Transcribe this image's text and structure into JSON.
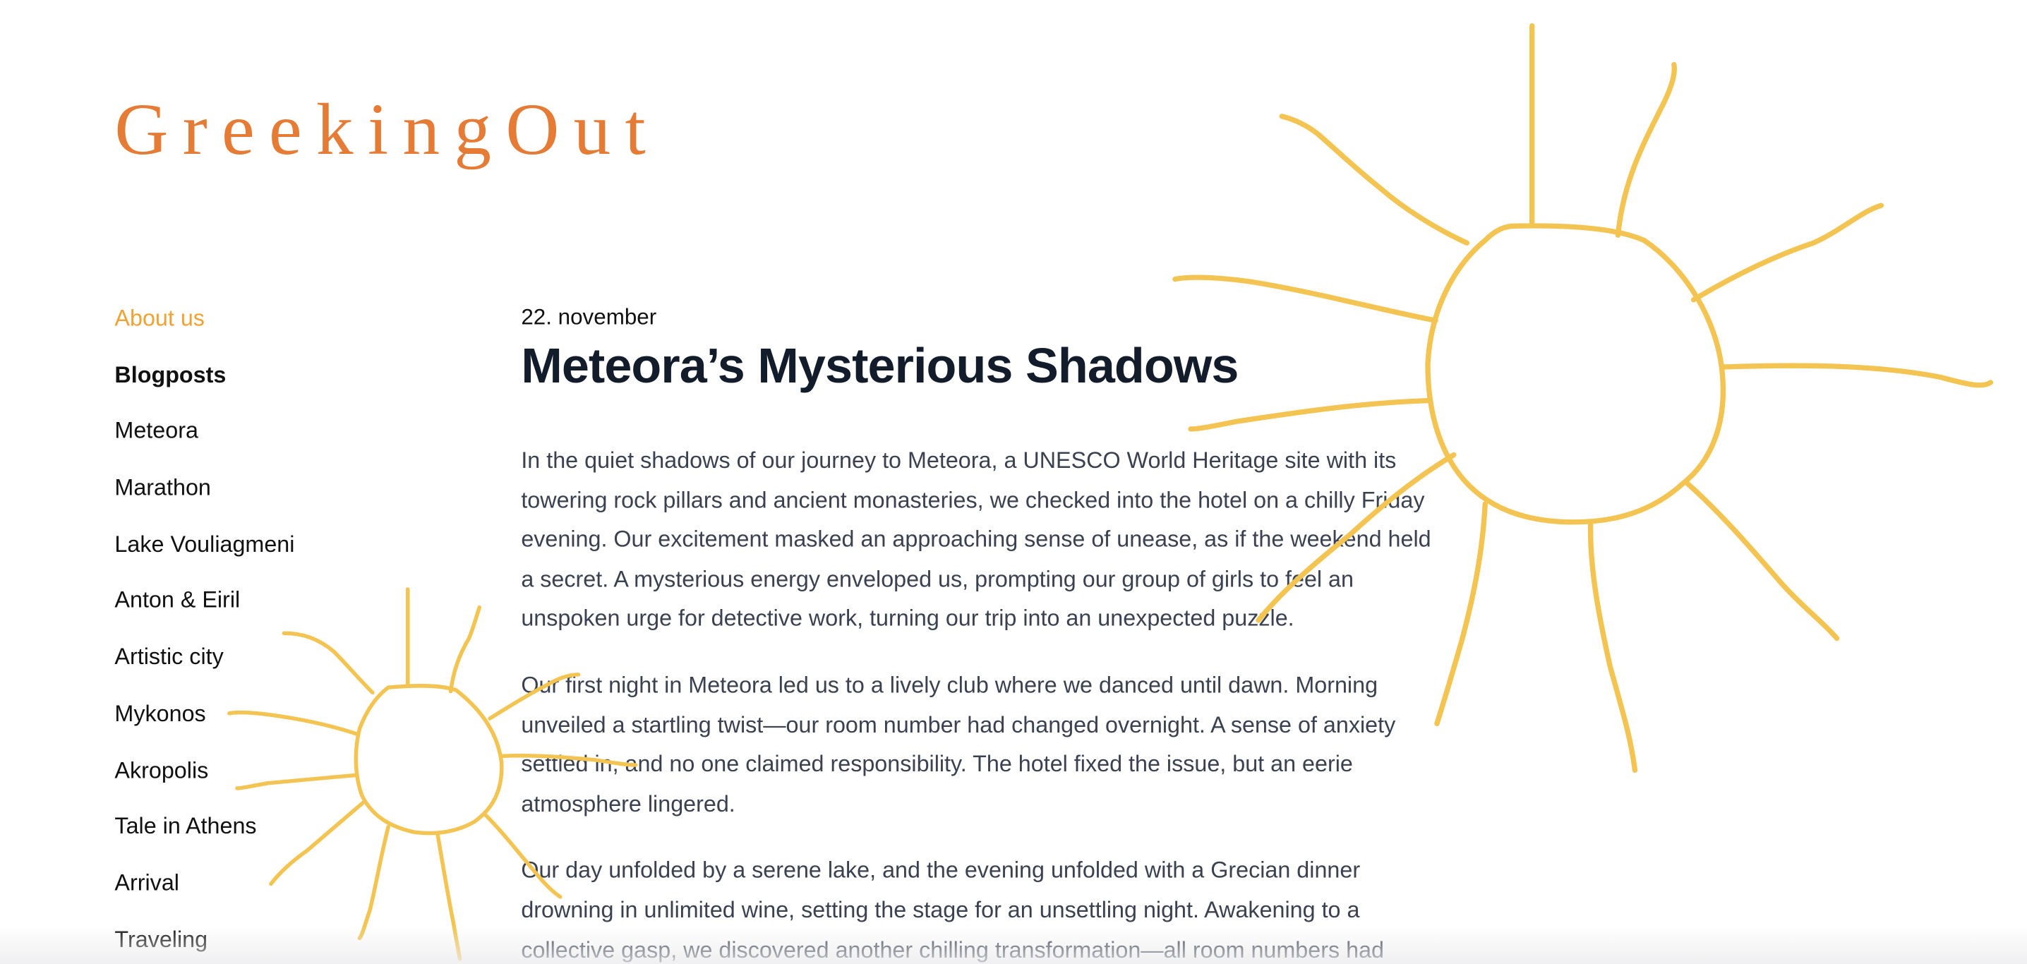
{
  "site": {
    "logo_text": "GreekingOut",
    "brand_color": "#e57b35",
    "active_nav_color": "#f0a233",
    "doodle_color": "#f3c451"
  },
  "sidebar": {
    "items": [
      {
        "label": "About us",
        "state": "active"
      },
      {
        "label": "Blogposts",
        "state": "heading"
      },
      {
        "label": "Meteora"
      },
      {
        "label": "Marathon"
      },
      {
        "label": "Lake Vouliagmeni"
      },
      {
        "label": "Anton & Eiril"
      },
      {
        "label": "Artistic city"
      },
      {
        "label": "Mykonos"
      },
      {
        "label": "Akropolis"
      },
      {
        "label": "Tale in Athens"
      },
      {
        "label": "Arrival"
      },
      {
        "label": "Traveling"
      }
    ]
  },
  "post": {
    "date": "22. november",
    "title": "Meteora’s Mysterious Shadows",
    "paragraphs": [
      "In the quiet shadows of our journey to Meteora, a UNESCO World Heritage site with its towering rock pillars and ancient monasteries, we checked into the hotel on a chilly Friday evening. Our excitement masked an approaching sense of unease, as if the weekend held a secret. A mysterious energy enveloped us, prompting our group of girls to feel an unspoken urge for detective work, turning our trip into an unexpected puzzle.",
      "Our first night in Meteora led us to a lively club where we danced until dawn. Morning unveiled a startling twist—our room number had changed overnight. A sense of anxiety settled in, and no one claimed responsibility. The hotel fixed the issue, but an eerie atmosphere lingered.",
      "Our day unfolded by a serene lake, and the evening unfolded with a Grecian dinner drowning in unlimited wine, setting the stage for an unsettling night. Awakening to a collective gasp, we discovered another chilling transformation—all room numbers had"
    ]
  },
  "decorations": {
    "large_sun": "sun-doodle-icon",
    "small_sun": "sun-doodle-icon"
  }
}
